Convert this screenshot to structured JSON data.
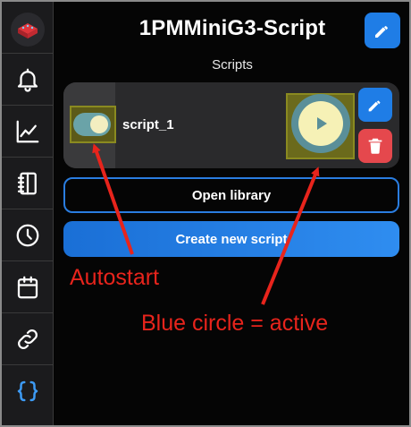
{
  "header": {
    "title": "1PMMiniG3-Script",
    "subtitle": "Scripts"
  },
  "sidebar": {
    "items": [
      {
        "icon": "device-logo-icon"
      },
      {
        "icon": "bell-icon"
      },
      {
        "icon": "chart-line-icon"
      },
      {
        "icon": "notebook-icon"
      },
      {
        "icon": "clock-icon"
      },
      {
        "icon": "calendar-icon"
      },
      {
        "icon": "link-icon"
      },
      {
        "icon": "code-braces-icon",
        "active": true
      }
    ]
  },
  "script_card": {
    "name": "script_1",
    "autostart": true,
    "running": true
  },
  "buttons": {
    "open_library": "Open library",
    "create_new": "Create new script"
  },
  "annotations": {
    "autostart": "Autostart",
    "blue_circle": "Blue circle = active"
  },
  "colors": {
    "accent_blue": "#1f7de6",
    "delete_red": "#e5484d",
    "annotation_red": "#e8241c",
    "highlight_yellow": "#6b6a1c"
  }
}
